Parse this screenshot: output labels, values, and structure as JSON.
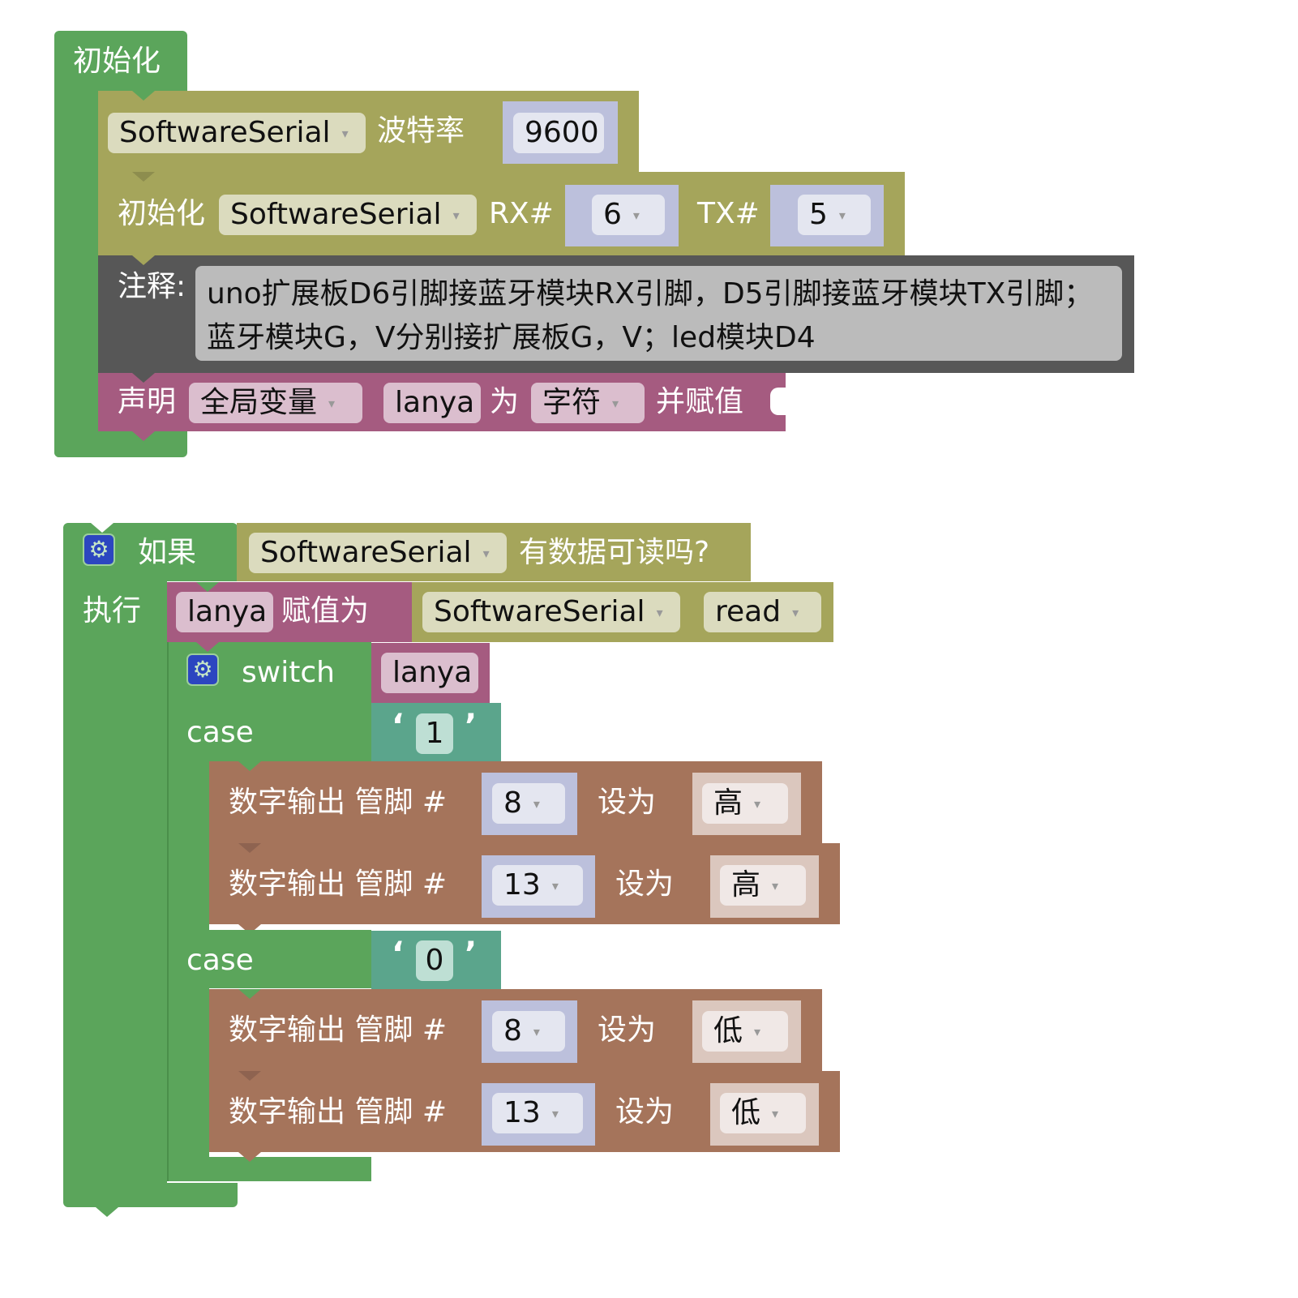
{
  "setup_block": {
    "title": "初始化",
    "serial_begin": {
      "serial": "SoftwareSerial",
      "label": "波特率",
      "baud": "9600"
    },
    "serial_init": {
      "label": "初始化",
      "serial": "SoftwareSerial",
      "rx_label": "RX#",
      "rx": "6",
      "tx_label": "TX#",
      "tx": "5"
    },
    "comment": {
      "label": "注释:",
      "line1": "uno扩展板D6引脚接蓝牙模块RX引脚，D5引脚接蓝牙模块TX引脚；",
      "line2": "蓝牙模块G，V分别接扩展板G，V；led模块D4"
    },
    "declare": {
      "label": "声明",
      "scope": "全局变量",
      "name": "lanya",
      "as_label": "为",
      "type": "字符",
      "assign_label": "并赋值"
    }
  },
  "loop_block": {
    "if_label": "如果",
    "condition": {
      "serial": "SoftwareSerial",
      "label": "有数据可读吗?"
    },
    "do_label": "执行",
    "assign": {
      "var": "lanya",
      "label": "赋值为",
      "serial": "SoftwareSerial",
      "method": "read"
    },
    "switch": {
      "label": "switch",
      "var": "lanya"
    },
    "cases": [
      {
        "label": "case",
        "value": "1",
        "actions": [
          {
            "label": "数字输出 管脚 #",
            "pin": "8",
            "set_label": "设为",
            "level": "高"
          },
          {
            "label": "数字输出 管脚 #",
            "pin": "13",
            "set_label": "设为",
            "level": "高"
          }
        ]
      },
      {
        "label": "case",
        "value": "0",
        "actions": [
          {
            "label": "数字输出 管脚 #",
            "pin": "8",
            "set_label": "设为",
            "level": "低"
          },
          {
            "label": "数字输出 管脚 #",
            "pin": "13",
            "set_label": "设为",
            "level": "低"
          }
        ]
      }
    ]
  },
  "icons": {
    "dropdown": "▾",
    "gear": "⚙",
    "open_quote": "‘",
    "close_quote": "’"
  }
}
